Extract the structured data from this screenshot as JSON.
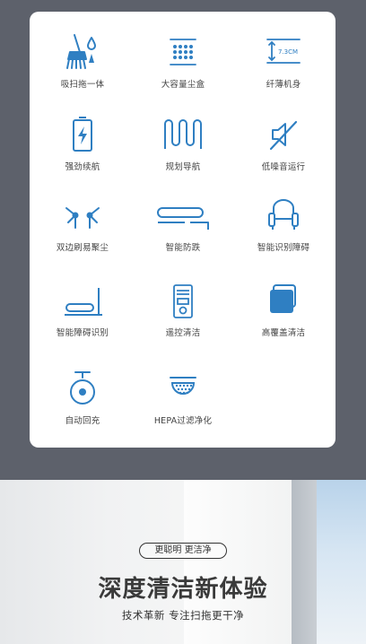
{
  "features": [
    {
      "label": "吸扫拖一体",
      "icon": "broom-mop-icon"
    },
    {
      "label": "大容量尘盒",
      "icon": "dust-box-icon"
    },
    {
      "label": "纤薄机身",
      "icon": "slim-body-icon"
    },
    {
      "label": "强劲续航",
      "icon": "battery-icon"
    },
    {
      "label": "规划导航",
      "icon": "navigation-path-icon"
    },
    {
      "label": "低噪音运行",
      "icon": "low-noise-icon"
    },
    {
      "label": "双边刷易聚尘",
      "icon": "side-brush-icon"
    },
    {
      "label": "智能防跌",
      "icon": "anti-fall-icon"
    },
    {
      "label": "智能识别障碍",
      "icon": "sofa-icon"
    },
    {
      "label": "智能障碍识别",
      "icon": "obstacle-icon"
    },
    {
      "label": "遥控清洁",
      "icon": "remote-control-icon"
    },
    {
      "label": "高覆盖清洁",
      "icon": "coverage-icon"
    },
    {
      "label": "自动回充",
      "icon": "auto-recharge-icon"
    },
    {
      "label": "HEPA过滤净化",
      "icon": "hepa-filter-icon"
    }
  ],
  "slim_height_text": "7.3CM",
  "banner": {
    "tag": "更聪明 更洁净",
    "title": "深度清洁新体验",
    "subtitle": "技术革新 专注扫拖更干净"
  },
  "colors": {
    "icon": "#2f7fc2",
    "background": "#5d616b",
    "card": "#ffffff"
  }
}
